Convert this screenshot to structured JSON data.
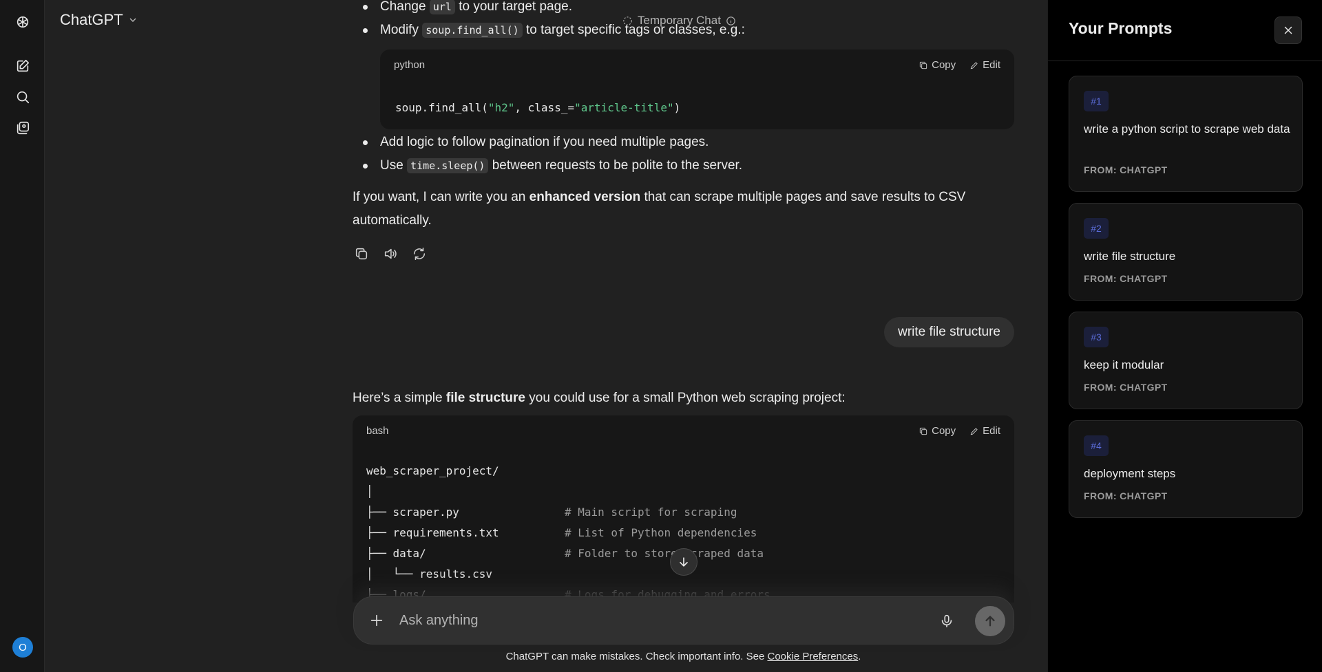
{
  "header": {
    "model_name": "ChatGPT",
    "temporary_chat_label": "Temporary Chat"
  },
  "sidebar": {
    "avatar_letter": "O"
  },
  "chat": {
    "bullets_top": {
      "b1_pre": "Change",
      "b1_code": "url",
      "b1_post": "to your target page.",
      "b2_pre": "Modify",
      "b2_code": "soup.find_all()",
      "b2_post": "to target specific tags or classes, e.g.:"
    },
    "code1": {
      "lang": "python",
      "copy_label": "Copy",
      "edit_label": "Edit",
      "line_pre": "soup.find_all(",
      "line_str1": "\"h2\"",
      "line_mid": ", class_=",
      "line_str2": "\"article-title\"",
      "line_post": ")"
    },
    "bullets_bottom": {
      "b3": "Add logic to follow pagination if you need multiple pages.",
      "b4_pre": "Use",
      "b4_code": "time.sleep()",
      "b4_post": "between requests to be polite to the server."
    },
    "para1": {
      "pre": "If you want, I can write you an",
      "bold": "enhanced version",
      "post": "that can scrape multiple pages and save results to CSV automatically."
    },
    "user_message": "write file structure",
    "para2": {
      "pre": "Here’s a simple",
      "bold": "file structure",
      "post": "you could use for a small Python web scraping project:"
    },
    "code2": {
      "lang": "bash",
      "copy_label": "Copy",
      "edit_label": "Edit",
      "lines": [
        {
          "code": "web_scraper_project/",
          "comment": ""
        },
        {
          "code": "│",
          "comment": ""
        },
        {
          "code": "├── scraper.py",
          "comment": "# Main script for scraping"
        },
        {
          "code": "├── requirements.txt",
          "comment": "# List of Python dependencies"
        },
        {
          "code": "├── data/",
          "comment": "# Folder to store scraped data"
        },
        {
          "code": "│   └── results.csv",
          "comment": ""
        },
        {
          "code": "├── logs/",
          "comment": "# Logs for debugging and errors"
        }
      ]
    }
  },
  "composer": {
    "placeholder": "Ask anything"
  },
  "footer": {
    "disclaimer": "ChatGPT can make mistakes. Check important info. See",
    "link": "Cookie Preferences",
    "suffix": "."
  },
  "prompts_panel": {
    "title": "Your Prompts",
    "items": [
      {
        "num": "#1",
        "text": "write a python script to scrape web data",
        "source": "FROM: CHATGPT"
      },
      {
        "num": "#2",
        "text": "write file structure",
        "source": "FROM: CHATGPT"
      },
      {
        "num": "#3",
        "text": "keep it modular",
        "source": "FROM: CHATGPT"
      },
      {
        "num": "#4",
        "text": "deployment steps",
        "source": "FROM: CHATGPT"
      }
    ]
  }
}
